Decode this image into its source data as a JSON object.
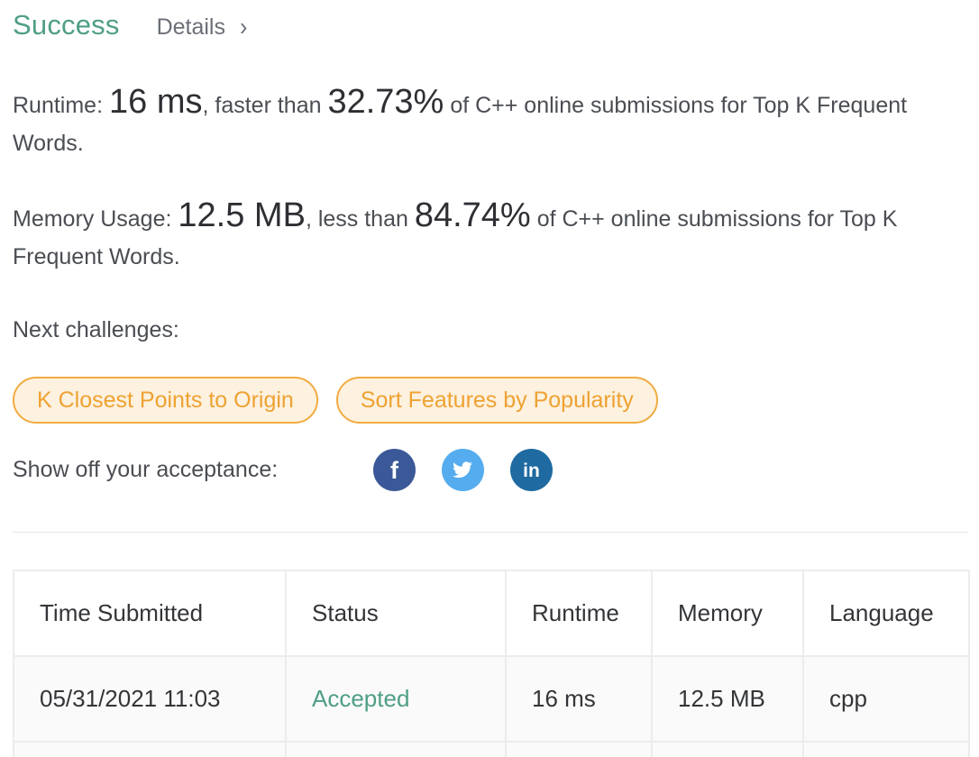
{
  "header": {
    "status": "Success",
    "details_label": "Details",
    "details_chevron": "›"
  },
  "runtime": {
    "label": "Runtime:",
    "value": "16 ms",
    "middle": ", faster than",
    "percent": "32.73%",
    "suffix": "of C++ online submissions for Top K Frequent Words."
  },
  "memory": {
    "label": "Memory Usage:",
    "value": "12.5 MB",
    "middle": ", less than",
    "percent": "84.74%",
    "suffix": "of C++ online submissions for Top K Frequent Words."
  },
  "next": {
    "label": "Next challenges:",
    "items": [
      "K Closest Points to Origin",
      "Sort Features by Popularity"
    ]
  },
  "share": {
    "label": "Show off your acceptance:",
    "icons": [
      {
        "name": "facebook-icon",
        "glyph": "f",
        "color": "#3b5998"
      },
      {
        "name": "twitter-icon",
        "glyph": "bird",
        "color": "#55acee"
      },
      {
        "name": "linkedin-icon",
        "glyph": "in",
        "color": "#1f6aa0"
      }
    ]
  },
  "colors": {
    "success": "#4f9e87",
    "pill_border": "#f0ac40",
    "pill_bg": "#fdf1df"
  },
  "table": {
    "headers": [
      "Time Submitted",
      "Status",
      "Runtime",
      "Memory",
      "Language"
    ],
    "rows": [
      [
        "05/31/2021 11:03",
        "Accepted",
        "16 ms",
        "12.5 MB",
        "cpp"
      ]
    ]
  }
}
